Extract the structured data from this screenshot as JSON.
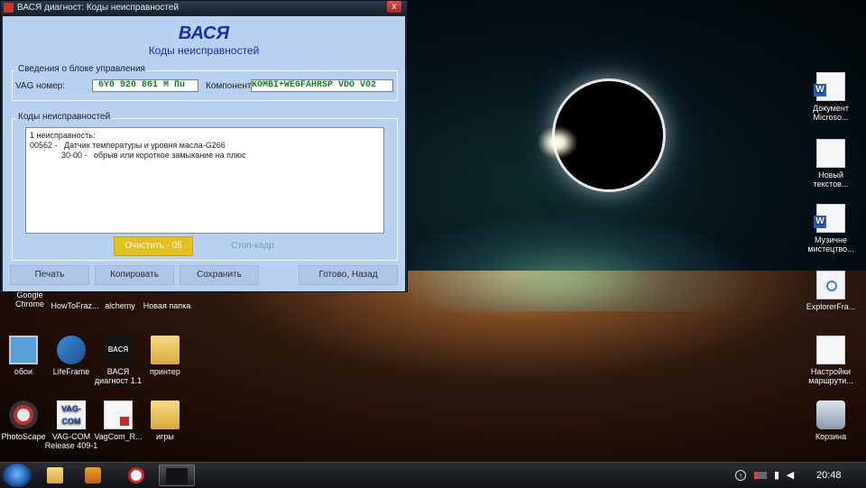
{
  "window": {
    "title": "ВАСЯ диагност: Коды неисправностей",
    "close_glyph": "x",
    "app_title": "ВАСЯ",
    "subtitle": "Коды неисправностей"
  },
  "control_unit": {
    "group_title": "Сведения о блоке управления",
    "vag_label": "VAG номер:",
    "vag_value": "6Y0 920 861 M Пu",
    "component_label": "Компонент:",
    "component_value": "KOMBI+WEGFAHRSP VDO V02"
  },
  "faults": {
    "group_title": "Коды неисправностей",
    "lines": [
      "1 неисправность:",
      "00562 -   Датчик температуры и уровня масла-G266",
      "              30-00 -   обрыв или короткое замыкание на плюс"
    ],
    "clear_button": "Очистить - 05",
    "freeze_frame_button": "Стоп-кадр"
  },
  "bottom_buttons": {
    "print": "Печать",
    "copy": "Копировать",
    "save": "Сохранить",
    "done": "Готово, Назад"
  },
  "desktop_icons": {
    "google_chrome": "Google\nChrome",
    "howto": "HowToFraz...",
    "alchemy": "alchemy",
    "new_folder": "Новая папка",
    "obi": "обои",
    "lifeframe": "LifeFrame",
    "vasya": "ВАСЯ\nдиагност 1.1",
    "printer": "принтер",
    "photoscape": "PhotoScape",
    "vagcom": "VAG-COM\nRelease 409-1",
    "vagcom_r": "VagCom_R...",
    "games": "игры",
    "doc_microsoft": "Документ\nMicroso...",
    "new_text": "Новый\nтекстов...",
    "music": "Музичне\nмистецтво...",
    "explorer_fra": "ExplorerFra...",
    "route_settings": "Настройки\nмаршрути...",
    "recycle_bin": "Корзина"
  },
  "desktop_icon_badges": {
    "vasya_logo": "ВАСЯ",
    "vagcom_logo": "VAG-\nCOM"
  },
  "taskbar": {
    "time": "20:48",
    "tray_icons": [
      "up-arrow-icon",
      "battery-icon",
      "signal-icon",
      "volume-icon"
    ],
    "pinned": [
      "windows-explorer",
      "media-player",
      "opera",
      "vasya-diagnost"
    ]
  }
}
